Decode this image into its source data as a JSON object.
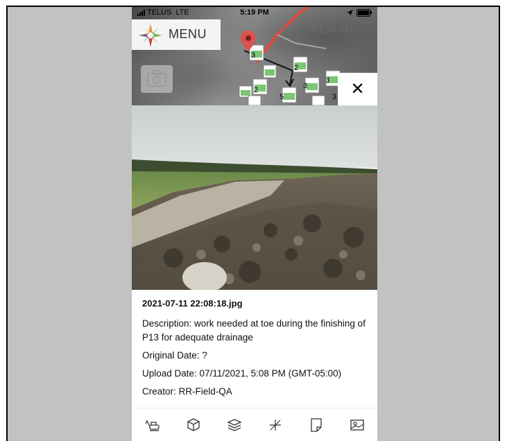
{
  "status_bar": {
    "carrier": "TELUS",
    "network": "LTE",
    "time": "5:19 PM"
  },
  "map": {
    "menu_label": "MENU",
    "imagery_layer": "Imagery_2021_03_12",
    "camera_icon": "camera-icon",
    "close_icon": "close-icon",
    "cluster_counts": [
      "3",
      "2",
      "2",
      "3",
      "5",
      "3",
      "3"
    ],
    "colors": {
      "marker": "#d9534f",
      "road": "#e04a3a"
    }
  },
  "photo": {
    "filename": "2021-07-11 22:08:18.jpg",
    "description": "Description: work needed at toe during the finishing of P13 for adequate drainage",
    "original_date": "Original Date: ?",
    "upload_date": "Upload Date: 07/11/2021, 5:08 PM (GMT-05:00)",
    "creator": "Creator: RR-Field-QA"
  },
  "toolbar": {
    "items": [
      {
        "icon": "excavator-icon"
      },
      {
        "icon": "cube-icon"
      },
      {
        "icon": "layers-icon"
      },
      {
        "icon": "measure-icon"
      },
      {
        "icon": "note-icon"
      },
      {
        "icon": "image-icon"
      }
    ]
  }
}
